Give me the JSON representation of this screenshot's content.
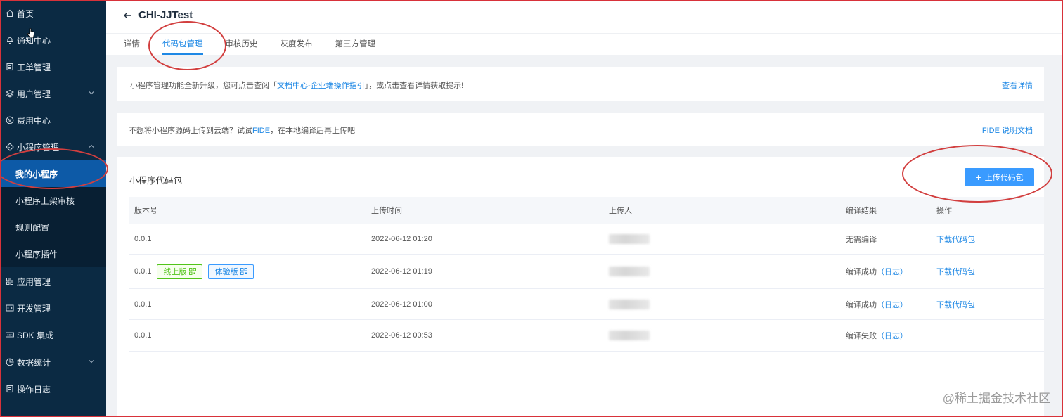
{
  "sidebar": {
    "items": [
      {
        "label": "首页",
        "icon": "home-icon"
      },
      {
        "label": "通知中心",
        "icon": "bell-icon"
      },
      {
        "label": "工单管理",
        "icon": "ticket-icon"
      },
      {
        "label": "用户管理",
        "icon": "layers-icon"
      },
      {
        "label": "费用中心",
        "icon": "yen-icon"
      },
      {
        "label": "小程序管理",
        "icon": "miniprogram-icon"
      },
      {
        "label": "应用管理",
        "icon": "grid-icon"
      },
      {
        "label": "开发管理",
        "icon": "code-icon"
      },
      {
        "label": "SDK 集成",
        "icon": "sdk-icon"
      },
      {
        "label": "数据统计",
        "icon": "pie-chart-icon"
      },
      {
        "label": "操作日志",
        "icon": "log-icon"
      }
    ],
    "subitems": [
      {
        "label": "我的小程序"
      },
      {
        "label": "小程序上架审核"
      },
      {
        "label": "规则配置"
      },
      {
        "label": "小程序插件"
      }
    ]
  },
  "header": {
    "title": "CHI-JJTest",
    "tabs": [
      "详情",
      "代码包管理",
      "审核历史",
      "灰度发布",
      "第三方管理"
    ]
  },
  "notice1": {
    "prefix": "小程序管理功能全新升级，您可点击查阅「",
    "link": "文档中心-企业端操作指引",
    "suffix": "」，或点击查看详情获取提示!",
    "right_link": "查看详情"
  },
  "notice2": {
    "prefix": "不想将小程序源码上传到云端？试试",
    "link": "FIDE",
    "suffix": "，在本地编译后再上传吧",
    "right_link": "FIDE 说明文档"
  },
  "code_section": {
    "title": "小程序代码包",
    "upload_button": "上传代码包",
    "columns": [
      "版本号",
      "上传时间",
      "上传人",
      "编译结果",
      "操作"
    ],
    "rows": [
      {
        "version": "0.0.1",
        "time": "2022-06-12 01:20",
        "result": "无需编译",
        "log": "",
        "action": "下载代码包",
        "tags": []
      },
      {
        "version": "0.0.1",
        "time": "2022-06-12 01:19",
        "result": "编译成功",
        "log": "（日志）",
        "action": "下载代码包",
        "tags": [
          "线上版",
          "体验版"
        ]
      },
      {
        "version": "0.0.1",
        "time": "2022-06-12 01:00",
        "result": "编译成功",
        "log": "（日志）",
        "action": "下载代码包",
        "tags": []
      },
      {
        "version": "0.0.1",
        "time": "2022-06-12 00:53",
        "result": "编译失败",
        "log": "（日志）",
        "action": "",
        "tags": []
      }
    ]
  },
  "watermark": "@稀土掘金技术社区",
  "colors": {
    "sidebar": "#0b2a43",
    "active": "#0d5aa7",
    "accent": "#1e88e5",
    "annotation": "#d23f3f"
  }
}
